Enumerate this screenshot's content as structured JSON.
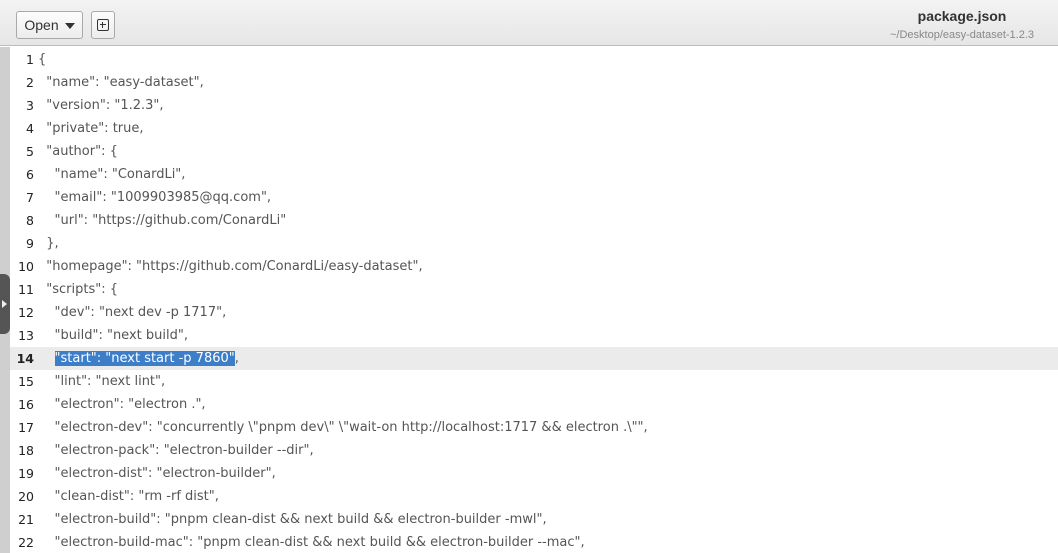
{
  "toolbar": {
    "open_label": "Open",
    "open_icon": "chevron-down-icon",
    "new_tab_icon": "new-document-icon"
  },
  "header": {
    "title": "package.json",
    "subtitle": "~/Desktop/easy-dataset-1.2.3"
  },
  "editor": {
    "current_line": 14,
    "lines": [
      {
        "n": "1",
        "text": "{"
      },
      {
        "n": "2",
        "text": "  \"name\": \"easy-dataset\","
      },
      {
        "n": "3",
        "text": "  \"version\": \"1.2.3\","
      },
      {
        "n": "4",
        "text": "  \"private\": true,"
      },
      {
        "n": "5",
        "text": "  \"author\": {"
      },
      {
        "n": "6",
        "text": "    \"name\": \"ConardLi\","
      },
      {
        "n": "7",
        "text": "    \"email\": \"1009903985@qq.com\","
      },
      {
        "n": "8",
        "text": "    \"url\": \"https://github.com/ConardLi\""
      },
      {
        "n": "9",
        "text": "  },"
      },
      {
        "n": "10",
        "text": "  \"homepage\": \"https://github.com/ConardLi/easy-dataset\","
      },
      {
        "n": "11",
        "text": "  \"scripts\": {"
      },
      {
        "n": "12",
        "text": "    \"dev\": \"next dev -p 1717\","
      },
      {
        "n": "13",
        "text": "    \"build\": \"next build\","
      },
      {
        "n": "14",
        "indent": "    ",
        "selected": "\"start\": \"next start -p 7860\"",
        "after": ","
      },
      {
        "n": "15",
        "text": "    \"lint\": \"next lint\","
      },
      {
        "n": "16",
        "text": "    \"electron\": \"electron .\","
      },
      {
        "n": "17",
        "text": "    \"electron-dev\": \"concurrently \\\"pnpm dev\\\" \\\"wait-on http://localhost:1717 && electron .\\\"\","
      },
      {
        "n": "18",
        "text": "    \"electron-pack\": \"electron-builder --dir\","
      },
      {
        "n": "19",
        "text": "    \"electron-dist\": \"electron-builder\","
      },
      {
        "n": "20",
        "text": "    \"clean-dist\": \"rm -rf dist\","
      },
      {
        "n": "21",
        "text": "    \"electron-build\": \"pnpm clean-dist && next build && electron-builder -mwl\","
      },
      {
        "n": "22",
        "text": "    \"electron-build-mac\": \"pnpm clean-dist && next build && electron-builder --mac\","
      }
    ]
  }
}
